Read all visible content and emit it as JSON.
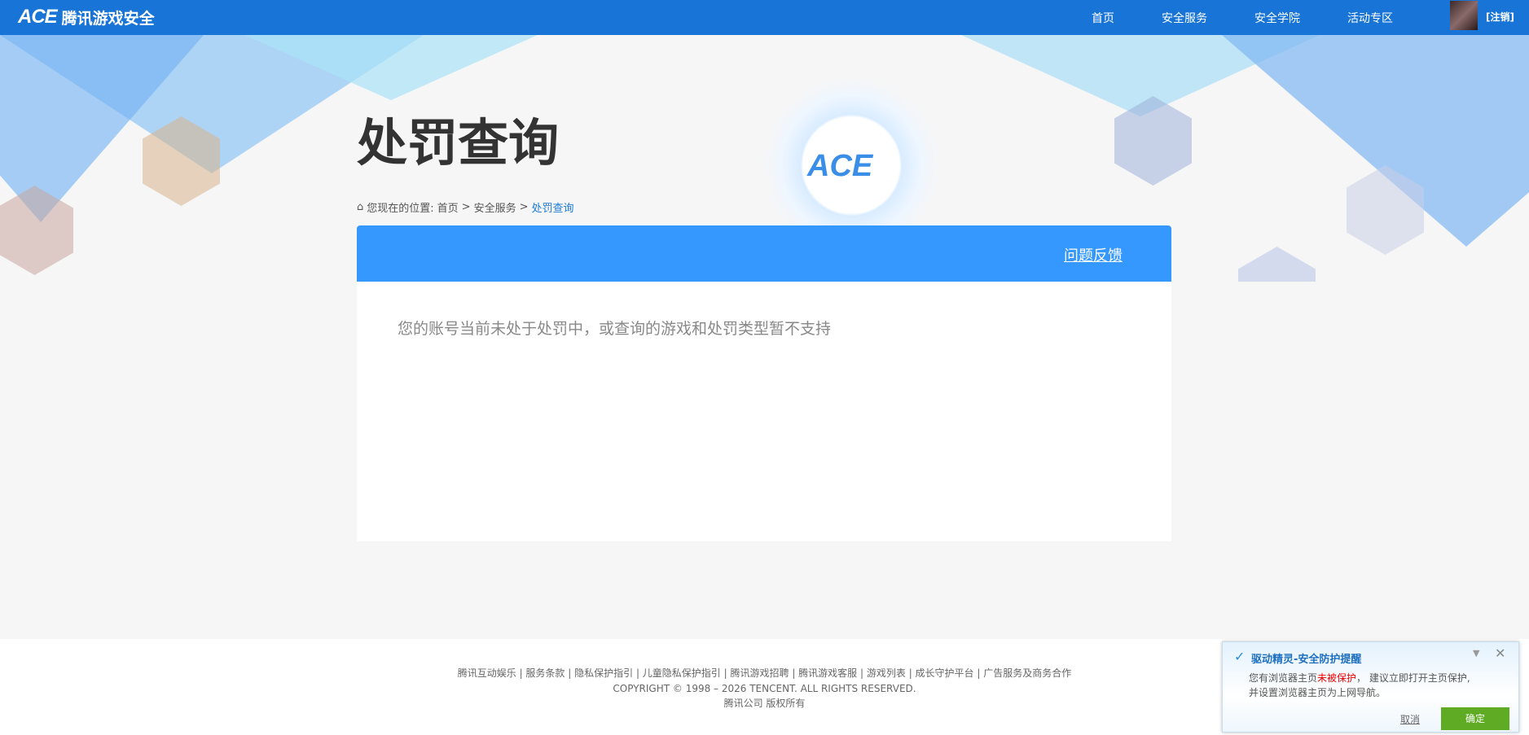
{
  "header": {
    "logo_mark": "ACE",
    "logo_text": "腾讯游戏安全",
    "nav": [
      "首页",
      "安全服务",
      "安全学院",
      "活动专区"
    ],
    "logout": "[注销]"
  },
  "banner": {
    "emblem": "ACE"
  },
  "page": {
    "title": "处罚查询",
    "breadcrumb": {
      "prefix": "您现在的位置:",
      "items": [
        "首页",
        "安全服务"
      ],
      "sep": ">",
      "current": "处罚查询"
    },
    "feedback": "问题反馈",
    "message": "您的账号当前未处于处罚中，或查询的游戏和处罚类型暂不支持"
  },
  "footer": {
    "links": [
      "腾讯互动娱乐",
      "服务条款",
      "隐私保护指引",
      "儿童隐私保护指引",
      "腾讯游戏招聘",
      "腾讯游戏客服",
      "游戏列表",
      "成长守护平台",
      "广告服务及商务合作"
    ],
    "copyright": "COPYRIGHT © 1998 – 2026 TENCENT. ALL RIGHTS RESERVED.",
    "company": "腾讯公司 版权所有"
  },
  "popup": {
    "title": "驱动精灵-安全防护提醒",
    "body_a": "您有浏览器主页",
    "body_red": "未被保护",
    "body_b": "， 建议立即打开主页保护,",
    "body_c": "并设置浏览器主页为上网导航。",
    "cancel": "取消",
    "ok": "确定"
  },
  "colors": {
    "header": "#1874d6",
    "card_head": "#3598fe",
    "ok": "#5fac24"
  }
}
